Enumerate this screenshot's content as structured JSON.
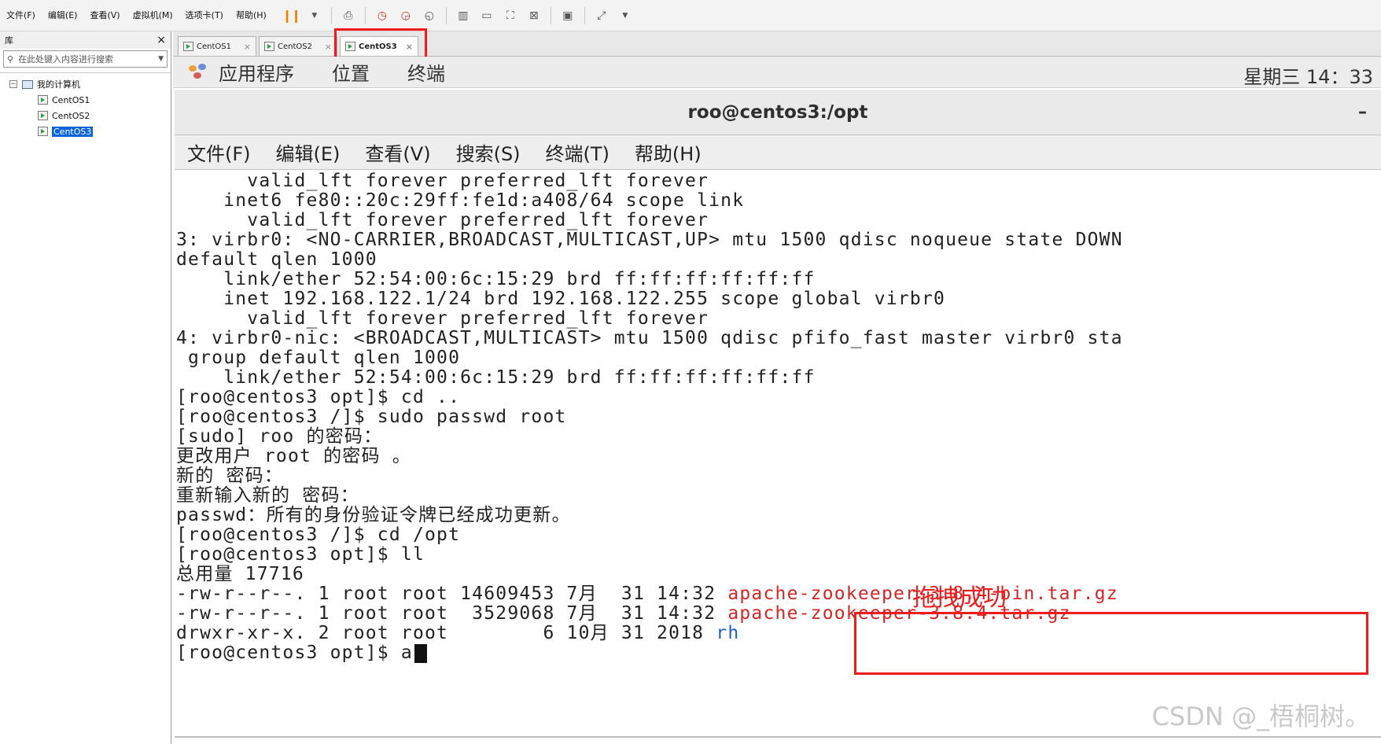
{
  "vmware": {
    "menu": [
      "文件(F)",
      "编辑(E)",
      "查看(V)",
      "虚拟机(M)",
      "选项卡(T)",
      "帮助(H)"
    ],
    "toolbar_icons": [
      "pause-icon",
      "dropdown-icon",
      "send-keys-icon",
      "snapshot-icon",
      "revert-snapshot-icon",
      "manage-snapshots-icon",
      "sidebar-icon",
      "console-icon",
      "fullscreen-icon",
      "unity-icon",
      "terminal-icon",
      "stretch-icon"
    ]
  },
  "sidebar": {
    "title": "库",
    "close": "×",
    "search_placeholder": "在此处键入内容进行搜索",
    "root": "我的计算机",
    "vms": [
      "CentOS1",
      "CentOS2",
      "CentOS3"
    ],
    "selected": "CentOS3"
  },
  "tabs": [
    {
      "label": "CentOS1",
      "active": false
    },
    {
      "label": "CentOS2",
      "active": false
    },
    {
      "label": "CentOS3",
      "active": true
    }
  ],
  "gnome": {
    "menu": [
      "应用程序",
      "位置",
      "终端"
    ],
    "clock": "星期三 14：33"
  },
  "terminal": {
    "title": "roo@centos3:/opt",
    "minimize": "–",
    "menu": [
      "文件(F)",
      "编辑(E)",
      "查看(V)",
      "搜索(S)",
      "终端(T)",
      "帮助(H)"
    ],
    "lines": [
      "      valid_lft forever preferred_lft forever",
      "    inet6 fe80::20c:29ff:fe1d:a408/64 scope link",
      "      valid_lft forever preferred_lft forever",
      "3: virbr0: <NO-CARRIER,BROADCAST,MULTICAST,UP> mtu 1500 qdisc noqueue state DOWN",
      "default qlen 1000",
      "    link/ether 52:54:00:6c:15:29 brd ff:ff:ff:ff:ff:ff",
      "    inet 192.168.122.1/24 brd 192.168.122.255 scope global virbr0",
      "      valid_lft forever preferred_lft forever",
      "4: virbr0-nic: <BROADCAST,MULTICAST> mtu 1500 qdisc pfifo_fast master virbr0 sta",
      " group default qlen 1000",
      "    link/ether 52:54:00:6c:15:29 brd ff:ff:ff:ff:ff:ff",
      "[roo@centos3 opt]$ cd ..",
      "[roo@centos3 /]$ sudo passwd root",
      "[sudo] roo 的密码：",
      "更改用户 root 的密码 。",
      "新的 密码：",
      "重新输入新的 密码：",
      "passwd：所有的身份验证令牌已经成功更新。",
      "[roo@centos3 /]$ cd /opt",
      "[roo@centos3 opt]$ ll",
      "总用量 17716"
    ],
    "listing": [
      {
        "prefix": "-rw-r--r--. 1 root root 14609453 7月  31 14:32 ",
        "name": "apache-zookeeper-3.8.4-bin.tar.gz",
        "color": "#d62525"
      },
      {
        "prefix": "-rw-r--r--. 1 root root  3529068 7月  31 14:32 ",
        "name": "apache-zookeeper-3.8.4.tar.gz",
        "color": "#d62525"
      },
      {
        "prefix": "drwxr-xr-x. 2 root root        6 10月 31 2018 ",
        "name": "rh",
        "color": "#1c5fd6"
      }
    ],
    "prompt": "[roo@centos3 opt]$ a"
  },
  "annotation": {
    "label": "拖拽成功",
    "color": "#ef1c1c"
  },
  "watermark": "CSDN @_梧桐树。"
}
